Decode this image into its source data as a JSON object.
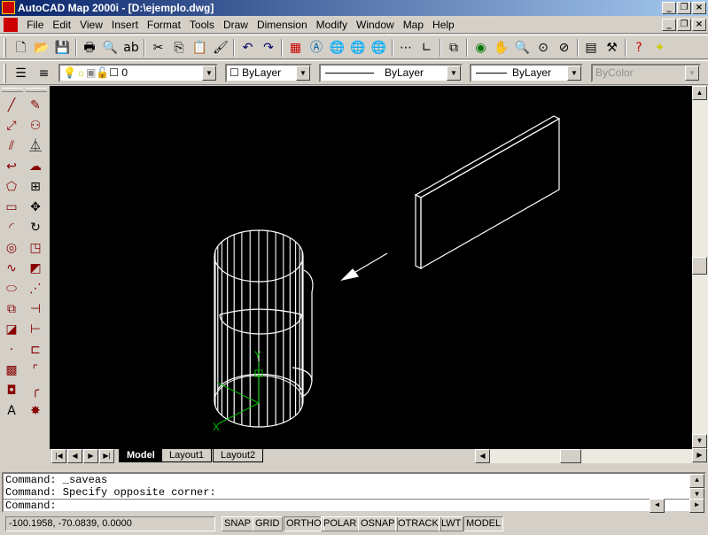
{
  "title": "AutoCAD Map 2000i - [D:\\ejemplo.dwg]",
  "menu": [
    "File",
    "Edit",
    "View",
    "Insert",
    "Format",
    "Tools",
    "Draw",
    "Dimension",
    "Modify",
    "Window",
    "Map",
    "Help"
  ],
  "standard_toolbar": [
    "new-icon",
    "open-icon",
    "save-icon",
    "|",
    "print-icon",
    "print-preview-icon",
    "spelling-icon",
    "|",
    "cut-icon",
    "copy-icon",
    "paste-icon",
    "match-properties-icon",
    "|",
    "undo-icon",
    "redo-icon",
    "|",
    "map-icon",
    "autodesk-point-a-icon",
    "publish-web-icon",
    "web-save-icon",
    "web-link-icon",
    "|",
    "tracking-icon",
    "ucs-icon",
    "|",
    "named-views-icon",
    "|",
    "3d-orbit-icon",
    "pan-icon",
    "zoom-realtime-icon",
    "zoom-window-icon",
    "zoom-previous-icon",
    "|",
    "properties-icon",
    "design-center-icon",
    "|",
    "help-icon",
    "whats-new-icon"
  ],
  "layer_combo": "0",
  "color_combo": "ByLayer",
  "linetype_combo": "ByLayer",
  "lineweight_combo": "ByLayer",
  "plotstyle_combo": "ByColor",
  "draw_toolbar": [
    "line",
    "construction-line",
    "multiline",
    "polyline",
    "polygon",
    "rectangle",
    "arc",
    "circle",
    "spline",
    "ellipse",
    "insert-block",
    "make-block",
    "point",
    "hatch",
    "region",
    "text"
  ],
  "modify_toolbar": [
    "erase",
    "copy",
    "mirror",
    "offset",
    "array",
    "move",
    "rotate",
    "scale",
    "stretch",
    "lengthen",
    "trim",
    "extend",
    "break",
    "chamfer",
    "fillet",
    "explode"
  ],
  "tabs": [
    "Model",
    "Layout1",
    "Layout2"
  ],
  "active_tab": "Model",
  "command_history": [
    "Command:  _saveas",
    "Command: Specify opposite corner:"
  ],
  "command_prompt": "Command:",
  "coordinates": "-100.1958, -70.0839, 0.0000",
  "status_buttons": [
    {
      "label": "SNAP",
      "on": false
    },
    {
      "label": "GRID",
      "on": false
    },
    {
      "label": "ORTHO",
      "on": true
    },
    {
      "label": "POLAR",
      "on": false
    },
    {
      "label": "OSNAP",
      "on": false
    },
    {
      "label": "OTRACK",
      "on": false
    },
    {
      "label": "LWT",
      "on": false
    },
    {
      "label": "MODEL",
      "on": true
    }
  ],
  "ucs_labels": {
    "x": "X",
    "y": "Y"
  },
  "colors": {
    "canvas": "#000000",
    "wire": "#ffffff",
    "ucs": "#00c000",
    "title_start": "#0a246a",
    "title_end": "#a6caf0"
  }
}
